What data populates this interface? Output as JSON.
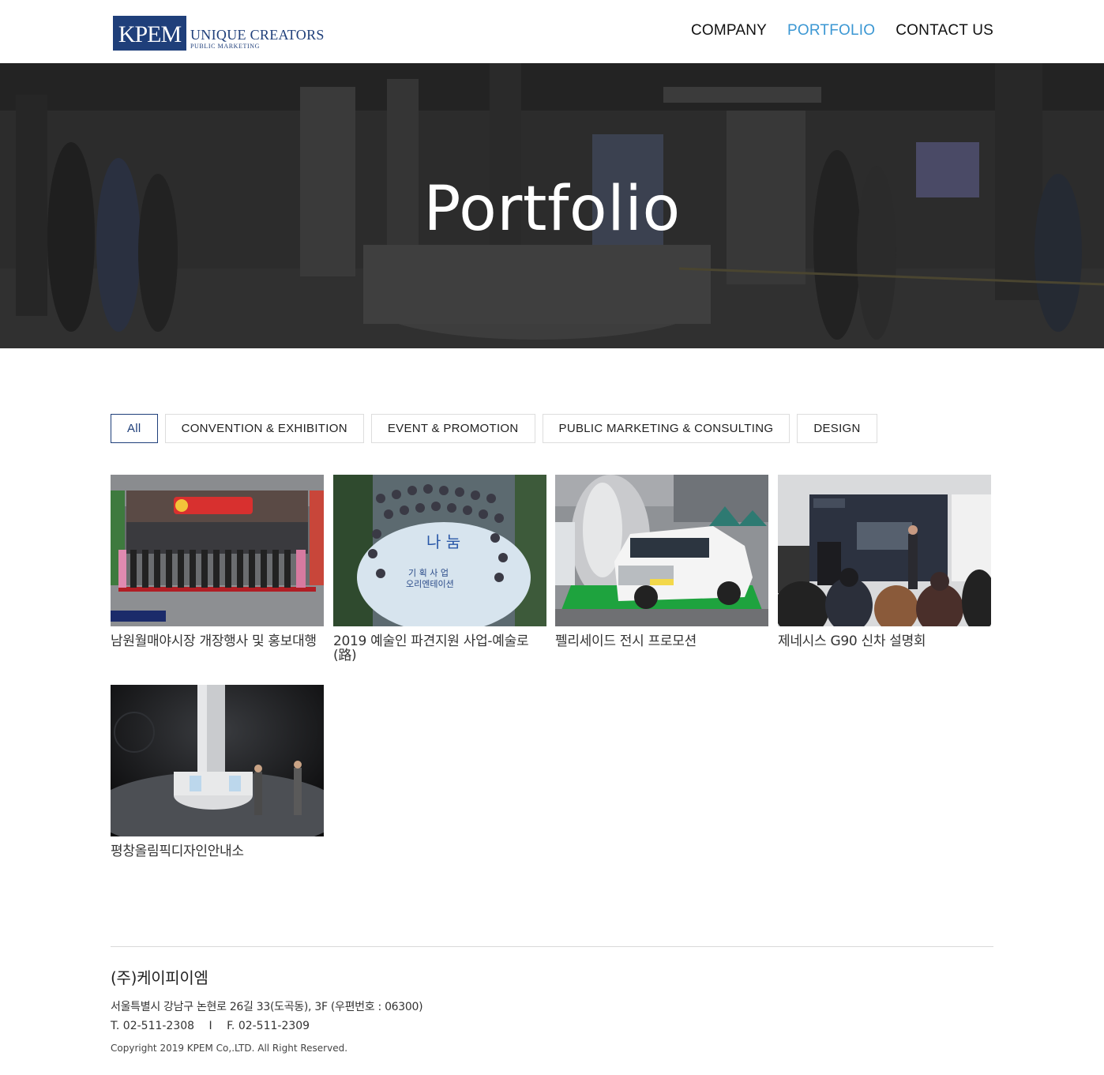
{
  "brand": {
    "logo_mark": "KPEM",
    "logo_main": "UNIQUE CREATORS",
    "logo_sub": "PUBLIC MARKETING",
    "primary_color": "#1f3f7a",
    "accent_color": "#3b97d3"
  },
  "nav": {
    "items": [
      {
        "label": "COMPANY",
        "active": false
      },
      {
        "label": "PORTFOLIO",
        "active": true
      },
      {
        "label": "CONTACT US",
        "active": false
      }
    ]
  },
  "hero": {
    "title": "Portfolio"
  },
  "filters": [
    {
      "label": "All",
      "active": true
    },
    {
      "label": "CONVENTION & EXHIBITION",
      "active": false
    },
    {
      "label": "EVENT & PROMOTION",
      "active": false
    },
    {
      "label": "PUBLIC MARKETING & CONSULTING",
      "active": false
    },
    {
      "label": "DESIGN",
      "active": false
    }
  ],
  "portfolio": [
    {
      "title": "남원월매야시장 개장행사 및 홍보대행",
      "thumb_icon": "market-opening-photo"
    },
    {
      "title": "2019 예술인 파견지원 사업-예술로(路)",
      "thumb_icon": "group-photo"
    },
    {
      "title": "펠리세이드 전시 프로모션",
      "thumb_icon": "suv-exhibition-photo"
    },
    {
      "title": "제네시스 G90 신차 설명회",
      "thumb_icon": "presentation-photo"
    },
    {
      "title": "평창올림픽디자인안내소",
      "thumb_icon": "info-booth-render"
    }
  ],
  "footer": {
    "company": "(주)케이피이엠",
    "address": "서울특별시 강남구 논현로 26길 33(도곡동), 3F (우편번호 : 06300)",
    "phone": "T. 02-511-2308",
    "separator": "I",
    "fax": "F. 02-511-2309",
    "copyright": "Copyright 2019 KPEM Co,.LTD. All Right Reserved."
  }
}
